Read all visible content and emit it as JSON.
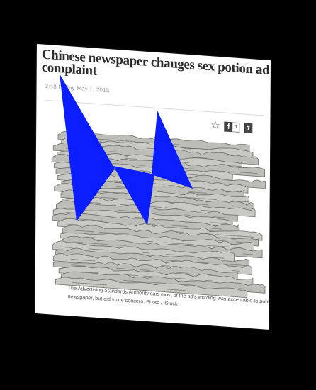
{
  "article": {
    "headline_line1": "Chinese newspaper changes sex potion ad",
    "headline_line2": "complaint",
    "dateline": "3:48 Friday May 1, 2015",
    "share": {
      "facebook_icon": "f",
      "facebook_count": "1",
      "twitter_icon": "t"
    },
    "photo_icon": "newspaper-stack-photo",
    "caption_line1": "The Advertising Standards Authority said most of the ad's wording was acceptable to publish in",
    "caption_line2": "newspaper, but did voice concern. Photo / iStock"
  },
  "colors": {
    "background": "#000000",
    "headline": "#2b2b2b",
    "overlay": "#0a1eff"
  }
}
